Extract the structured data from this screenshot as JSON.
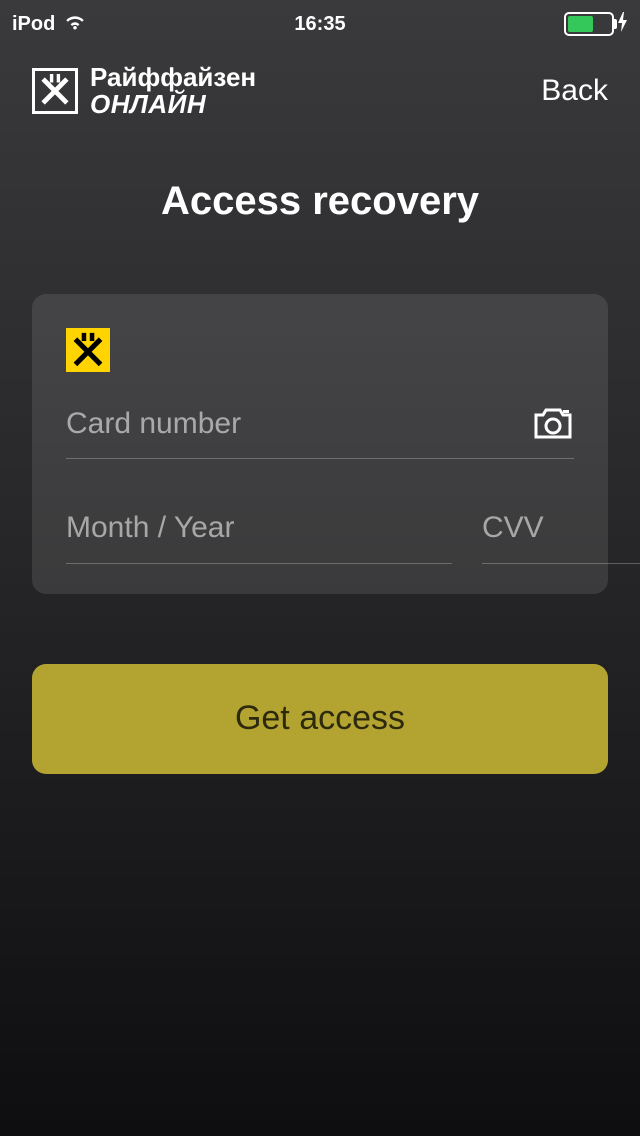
{
  "status_bar": {
    "device": "iPod",
    "time": "16:35"
  },
  "header": {
    "brand_line1": "Райффайзен",
    "brand_line2": "ОНЛАЙН",
    "back_label": "Back"
  },
  "title": "Access recovery",
  "form": {
    "card_number": {
      "placeholder": "Card number",
      "value": ""
    },
    "expiry": {
      "placeholder": "Month / Year",
      "value": ""
    },
    "cvv": {
      "placeholder": "CVV",
      "value": ""
    }
  },
  "button": {
    "get_access": "Get access"
  },
  "icons": {
    "wifi": "wifi-icon",
    "battery": "battery-icon",
    "charging": "charging-icon",
    "brand_logo": "raiffeisen-logo-icon",
    "bank_small": "raiffeisen-small-icon",
    "camera": "camera-icon",
    "help": "help-icon"
  },
  "colors": {
    "accent_yellow": "#ffd400",
    "button_yellow": "#b3a432",
    "battery_green": "#34c759"
  }
}
